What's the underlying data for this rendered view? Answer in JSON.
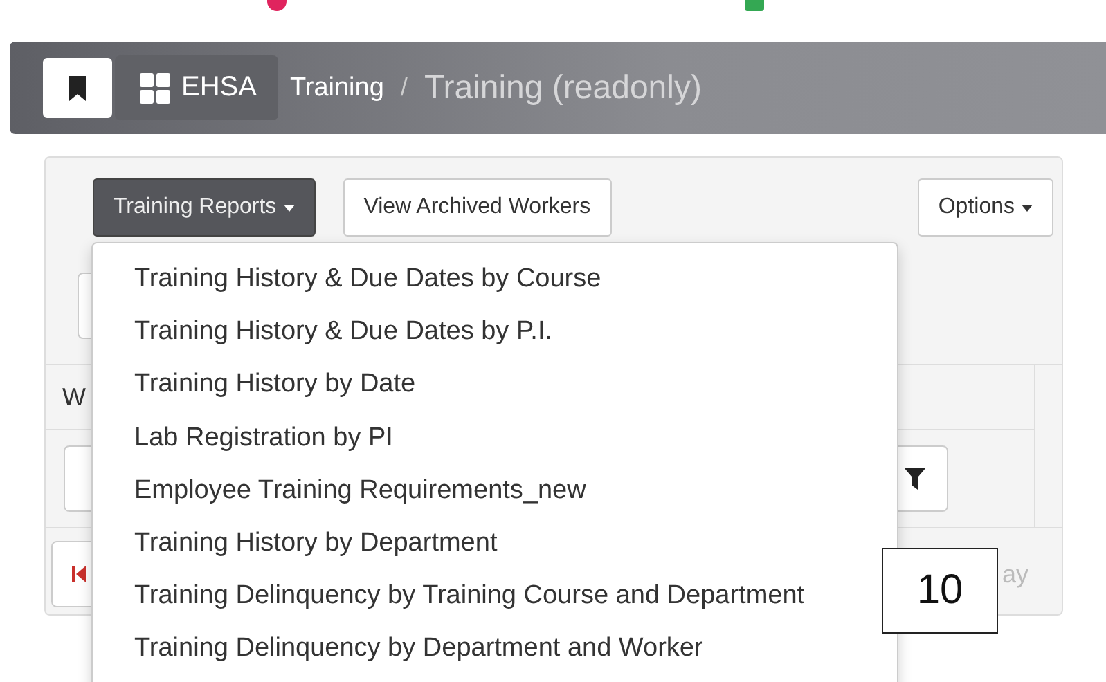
{
  "header": {
    "brand": "EHSA",
    "separator": "/",
    "breadcrumb": [
      {
        "label": "Training",
        "current": false
      },
      {
        "label": "Training (readonly)",
        "current": true
      }
    ]
  },
  "toolbar": {
    "reports_button": "Training Reports",
    "archived_button": "View Archived Workers",
    "options_button": "Options"
  },
  "table": {
    "column_1": "W",
    "pager_text": "ay"
  },
  "reports_menu": {
    "open": true,
    "items": [
      "Training History & Due Dates by Course",
      "Training History & Due Dates by P.I.",
      "Training History by Date",
      "Lab Registration by PI",
      "Employee Training Requirements_new",
      "Training History by Department",
      "Training Delinquency by Training Course and Department",
      "Training Delinquency by Department and Worker"
    ]
  },
  "callout": "10"
}
